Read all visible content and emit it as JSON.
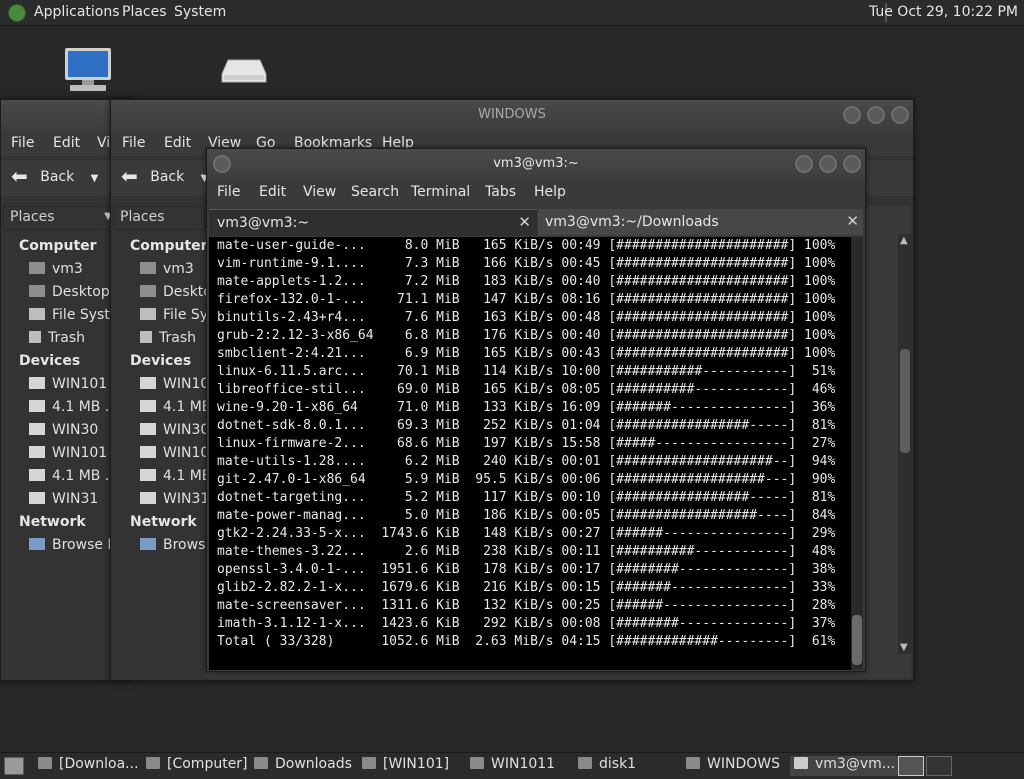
{
  "top_panel": {
    "menus": [
      "Applications",
      "Places",
      "System"
    ],
    "clock": "Tue Oct 29, 10:22 PM"
  },
  "back_window": {
    "menu": [
      "File",
      "Edit",
      "Vi"
    ],
    "back_label": "Back",
    "places_label": "Places",
    "sidebar": {
      "computer_header": "Computer",
      "computer_items": [
        "vm3",
        "Desktop",
        "File Syster",
        "Trash"
      ],
      "devices_header": "Devices",
      "devices_items": [
        "WIN101",
        "4.1 MB ...",
        "WIN30",
        "WIN101",
        "4.1 MB ...",
        "WIN31"
      ],
      "network_header": "Network",
      "network_items": [
        "Browse N"
      ]
    }
  },
  "files_window": {
    "title": "WINDOWS",
    "menu": [
      "File",
      "Edit",
      "View",
      "Go",
      "Bookmarks",
      "Help"
    ],
    "back_label": "Back",
    "places_label": "Places",
    "sidebar": {
      "computer_header": "Computer",
      "computer_items": [
        "vm3",
        "Deskto",
        "File Sys",
        "Trash"
      ],
      "devices_header": "Devices",
      "devices_items": [
        "WIN101",
        "4.1 MB",
        "WIN30",
        "WIN101",
        "4.1 MB",
        "WIN31"
      ],
      "network_header": "Network",
      "network_items": [
        "Browse"
      ]
    }
  },
  "terminal": {
    "title": "vm3@vm3:~",
    "menu": [
      "File",
      "Edit",
      "View",
      "Search",
      "Terminal",
      "Tabs",
      "Help"
    ],
    "tabs": [
      {
        "label": "vm3@vm3:~"
      },
      {
        "label": "vm3@vm3:~/Downloads"
      }
    ],
    "lines": [
      "mate-user-guide-...     8.0 MiB   165 KiB/s 00:49 [######################] 100%",
      "vim-runtime-9.1....     7.3 MiB   166 KiB/s 00:45 [######################] 100%",
      "mate-applets-1.2...     7.2 MiB   183 KiB/s 00:40 [######################] 100%",
      "firefox-132.0-1-...    71.1 MiB   147 KiB/s 08:16 [######################] 100%",
      "binutils-2.43+r4...     7.6 MiB   163 KiB/s 00:48 [######################] 100%",
      "grub-2:2.12-3-x86_64    6.8 MiB   176 KiB/s 00:40 [######################] 100%",
      "smbclient-2:4.21...     6.9 MiB   165 KiB/s 00:43 [######################] 100%",
      "linux-6.11.5.arc...    70.1 MiB   114 KiB/s 10:00 [###########-----------]  51%",
      "libreoffice-stil...    69.0 MiB   165 KiB/s 08:05 [##########------------]  46%",
      "wine-9.20-1-x86_64     71.0 MiB   133 KiB/s 16:09 [#######---------------]  36%",
      "dotnet-sdk-8.0.1...    69.3 MiB   252 KiB/s 01:04 [#################-----]  81%",
      "linux-firmware-2...    68.6 MiB   197 KiB/s 15:58 [#####-----------------]  27%",
      "mate-utils-1.28....     6.2 MiB   240 KiB/s 00:01 [####################--]  94%",
      "git-2.47.0-1-x86_64     5.9 MiB  95.5 KiB/s 00:06 [###################---]  90%",
      "dotnet-targeting...     5.2 MiB   117 KiB/s 00:10 [#################-----]  81%",
      "mate-power-manag...     5.0 MiB   186 KiB/s 00:05 [##################----]  84%",
      "gtk2-2.24.33-5-x...  1743.6 KiB   148 KiB/s 00:27 [######----------------]  29%",
      "mate-themes-3.22...     2.6 MiB   238 KiB/s 00:11 [##########------------]  48%",
      "openssl-3.4.0-1-...  1951.6 KiB   178 KiB/s 00:17 [########--------------]  38%",
      "glib2-2.82.2-1-x...  1679.6 KiB   216 KiB/s 00:15 [#######---------------]  33%",
      "mate-screensaver...  1311.6 KiB   132 KiB/s 00:25 [######----------------]  28%",
      "imath-3.1.12-1-x...  1423.6 KiB   292 KiB/s 00:08 [########--------------]  37%",
      "Total ( 33/328)      1052.6 MiB  2.63 MiB/s 04:15 [#############---------]  61%"
    ]
  },
  "taskbar": {
    "items": [
      "[Downloa...",
      "[Computer]",
      "Downloads",
      "[WIN101]",
      "WIN1011",
      "disk1",
      "WINDOWS",
      "vm3@vm..."
    ]
  }
}
